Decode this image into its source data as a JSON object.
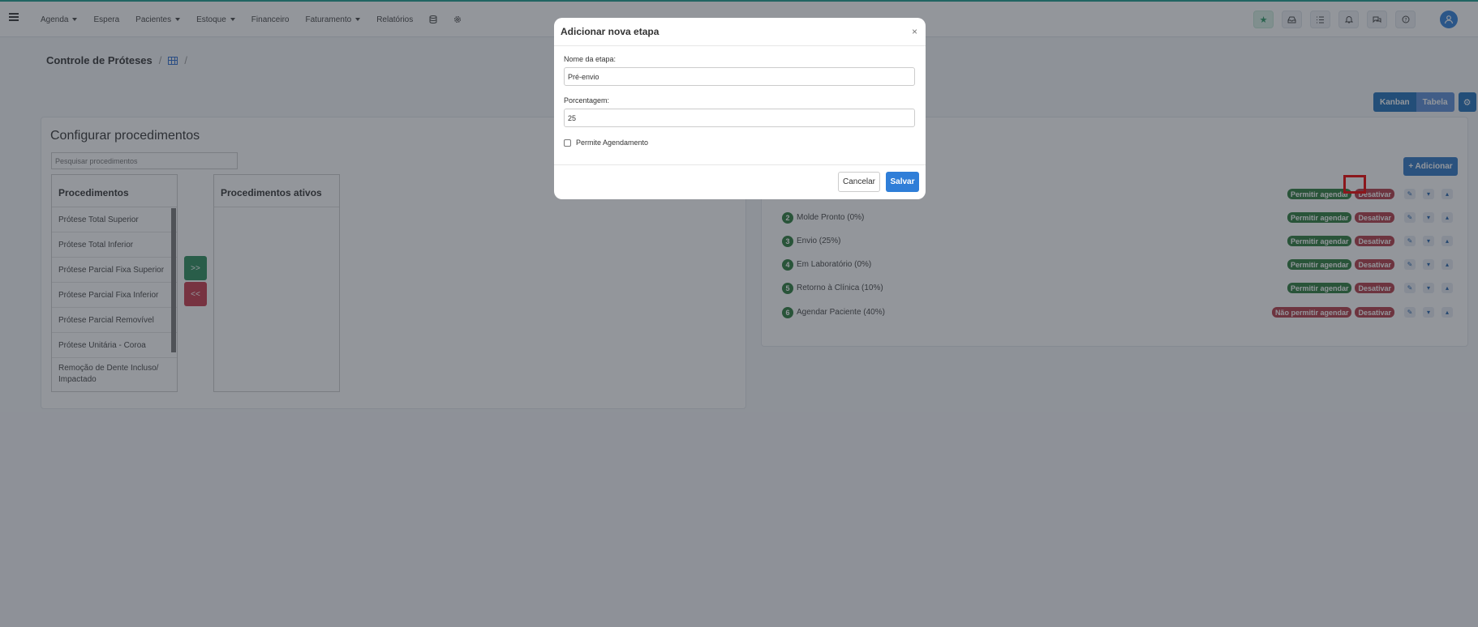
{
  "nav": {
    "items": [
      {
        "label": "Agenda",
        "dropdown": true
      },
      {
        "label": "Espera",
        "dropdown": false
      },
      {
        "label": "Pacientes",
        "dropdown": true
      },
      {
        "label": "Estoque",
        "dropdown": true
      },
      {
        "label": "Financeiro",
        "dropdown": false
      },
      {
        "label": "Faturamento",
        "dropdown": true
      },
      {
        "label": "Relatórios",
        "dropdown": false
      }
    ],
    "right_icons": [
      "star-icon",
      "inbox-icon",
      "checklist-icon",
      "bell-icon",
      "chat-icon",
      "help-icon"
    ],
    "accent": "#1a9b8c"
  },
  "page": {
    "title": "Controle de Próteses",
    "sep1": "/",
    "sep2": "/"
  },
  "view_toggle": {
    "kanban": "Kanban",
    "tabela": "Tabela",
    "gear": "⚙"
  },
  "config": {
    "title": "Configurar procedimentos",
    "search_placeholder": "Pesquisar procedimentos",
    "procedures_header": "Procedimentos",
    "active_header": "Procedimentos ativos",
    "move_right": ">>",
    "move_left": "<<",
    "procedures": [
      "Prótese Total Superior",
      "Prótese Total Inferior",
      "Prótese Parcial Fixa Superior",
      "Prótese Parcial Fixa Inferior",
      "Prótese Parcial Removível",
      "Prótese Unitária - Coroa",
      "Remoção de Dente Incluso/ Impactado"
    ]
  },
  "stages": {
    "add_label": "+ Adicionar",
    "rows": [
      {
        "num": "",
        "name": "",
        "schedule": "Permitir agendar",
        "disable": "Desativar"
      },
      {
        "num": "2",
        "name": "Molde Pronto  (0%)",
        "schedule": "Permitir agendar",
        "disable": "Desativar"
      },
      {
        "num": "3",
        "name": "Envio  (25%)",
        "schedule": "Permitir agendar",
        "disable": "Desativar"
      },
      {
        "num": "4",
        "name": "Em Laboratório  (0%)",
        "schedule": "Permitir agendar",
        "disable": "Desativar"
      },
      {
        "num": "5",
        "name": "Retorno à Clínica  (10%)",
        "schedule": "Permitir agendar",
        "disable": "Desativar"
      },
      {
        "num": "6",
        "name": "Agendar Paciente  (40%)",
        "schedule": "Não permitir agendar",
        "disable": "Desativar"
      }
    ],
    "edit_icon": "✎",
    "down_icon": "▾",
    "up_icon": "▴",
    "colors": {
      "green": "#2a7a3b",
      "red": "#b33a46"
    }
  },
  "modal": {
    "title": "Adicionar nova etapa",
    "close": "×",
    "name_label": "Nome da etapa:",
    "name_value": "Pré-envio",
    "percent_label": "Porcentagem:",
    "percent_value": "25",
    "checkbox_label": "Permite Agendamento",
    "cancel": "Cancelar",
    "save": "Salvar"
  }
}
